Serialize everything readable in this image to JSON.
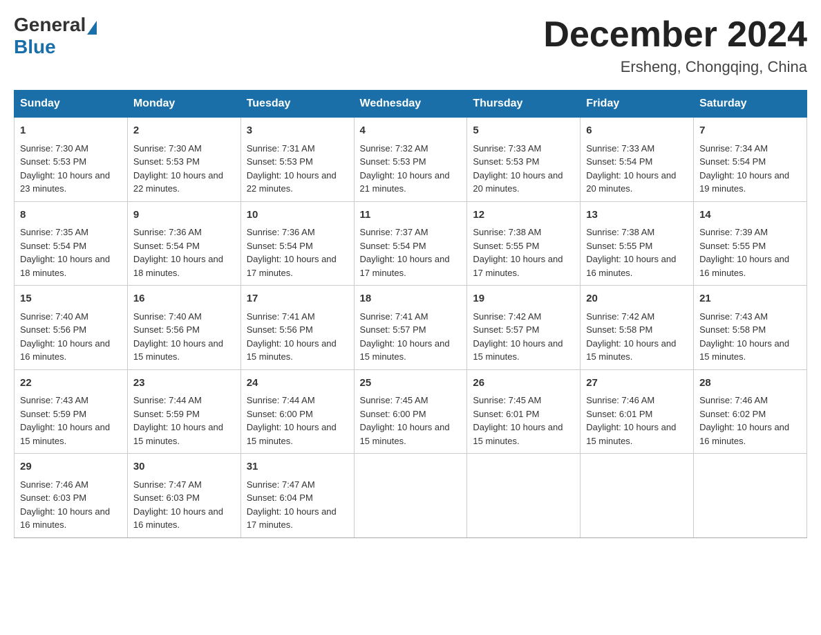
{
  "logo": {
    "general": "General",
    "blue": "Blue"
  },
  "header": {
    "month_year": "December 2024",
    "location": "Ersheng, Chongqing, China"
  },
  "days_of_week": [
    "Sunday",
    "Monday",
    "Tuesday",
    "Wednesday",
    "Thursday",
    "Friday",
    "Saturday"
  ],
  "weeks": [
    [
      {
        "day": "1",
        "sunrise": "7:30 AM",
        "sunset": "5:53 PM",
        "daylight": "10 hours and 23 minutes."
      },
      {
        "day": "2",
        "sunrise": "7:30 AM",
        "sunset": "5:53 PM",
        "daylight": "10 hours and 22 minutes."
      },
      {
        "day": "3",
        "sunrise": "7:31 AM",
        "sunset": "5:53 PM",
        "daylight": "10 hours and 22 minutes."
      },
      {
        "day": "4",
        "sunrise": "7:32 AM",
        "sunset": "5:53 PM",
        "daylight": "10 hours and 21 minutes."
      },
      {
        "day": "5",
        "sunrise": "7:33 AM",
        "sunset": "5:53 PM",
        "daylight": "10 hours and 20 minutes."
      },
      {
        "day": "6",
        "sunrise": "7:33 AM",
        "sunset": "5:54 PM",
        "daylight": "10 hours and 20 minutes."
      },
      {
        "day": "7",
        "sunrise": "7:34 AM",
        "sunset": "5:54 PM",
        "daylight": "10 hours and 19 minutes."
      }
    ],
    [
      {
        "day": "8",
        "sunrise": "7:35 AM",
        "sunset": "5:54 PM",
        "daylight": "10 hours and 18 minutes."
      },
      {
        "day": "9",
        "sunrise": "7:36 AM",
        "sunset": "5:54 PM",
        "daylight": "10 hours and 18 minutes."
      },
      {
        "day": "10",
        "sunrise": "7:36 AM",
        "sunset": "5:54 PM",
        "daylight": "10 hours and 17 minutes."
      },
      {
        "day": "11",
        "sunrise": "7:37 AM",
        "sunset": "5:54 PM",
        "daylight": "10 hours and 17 minutes."
      },
      {
        "day": "12",
        "sunrise": "7:38 AM",
        "sunset": "5:55 PM",
        "daylight": "10 hours and 17 minutes."
      },
      {
        "day": "13",
        "sunrise": "7:38 AM",
        "sunset": "5:55 PM",
        "daylight": "10 hours and 16 minutes."
      },
      {
        "day": "14",
        "sunrise": "7:39 AM",
        "sunset": "5:55 PM",
        "daylight": "10 hours and 16 minutes."
      }
    ],
    [
      {
        "day": "15",
        "sunrise": "7:40 AM",
        "sunset": "5:56 PM",
        "daylight": "10 hours and 16 minutes."
      },
      {
        "day": "16",
        "sunrise": "7:40 AM",
        "sunset": "5:56 PM",
        "daylight": "10 hours and 15 minutes."
      },
      {
        "day": "17",
        "sunrise": "7:41 AM",
        "sunset": "5:56 PM",
        "daylight": "10 hours and 15 minutes."
      },
      {
        "day": "18",
        "sunrise": "7:41 AM",
        "sunset": "5:57 PM",
        "daylight": "10 hours and 15 minutes."
      },
      {
        "day": "19",
        "sunrise": "7:42 AM",
        "sunset": "5:57 PM",
        "daylight": "10 hours and 15 minutes."
      },
      {
        "day": "20",
        "sunrise": "7:42 AM",
        "sunset": "5:58 PM",
        "daylight": "10 hours and 15 minutes."
      },
      {
        "day": "21",
        "sunrise": "7:43 AM",
        "sunset": "5:58 PM",
        "daylight": "10 hours and 15 minutes."
      }
    ],
    [
      {
        "day": "22",
        "sunrise": "7:43 AM",
        "sunset": "5:59 PM",
        "daylight": "10 hours and 15 minutes."
      },
      {
        "day": "23",
        "sunrise": "7:44 AM",
        "sunset": "5:59 PM",
        "daylight": "10 hours and 15 minutes."
      },
      {
        "day": "24",
        "sunrise": "7:44 AM",
        "sunset": "6:00 PM",
        "daylight": "10 hours and 15 minutes."
      },
      {
        "day": "25",
        "sunrise": "7:45 AM",
        "sunset": "6:00 PM",
        "daylight": "10 hours and 15 minutes."
      },
      {
        "day": "26",
        "sunrise": "7:45 AM",
        "sunset": "6:01 PM",
        "daylight": "10 hours and 15 minutes."
      },
      {
        "day": "27",
        "sunrise": "7:46 AM",
        "sunset": "6:01 PM",
        "daylight": "10 hours and 15 minutes."
      },
      {
        "day": "28",
        "sunrise": "7:46 AM",
        "sunset": "6:02 PM",
        "daylight": "10 hours and 16 minutes."
      }
    ],
    [
      {
        "day": "29",
        "sunrise": "7:46 AM",
        "sunset": "6:03 PM",
        "daylight": "10 hours and 16 minutes."
      },
      {
        "day": "30",
        "sunrise": "7:47 AM",
        "sunset": "6:03 PM",
        "daylight": "10 hours and 16 minutes."
      },
      {
        "day": "31",
        "sunrise": "7:47 AM",
        "sunset": "6:04 PM",
        "daylight": "10 hours and 17 minutes."
      },
      null,
      null,
      null,
      null
    ]
  ]
}
